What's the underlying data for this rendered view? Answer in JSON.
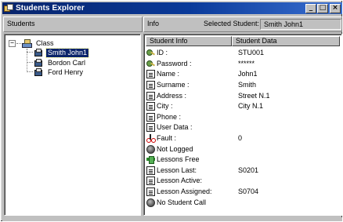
{
  "window": {
    "title": "Students Explorer",
    "controls": [
      "_",
      "□",
      "×"
    ]
  },
  "header": {
    "students_label": "Students",
    "info_label": "Info",
    "selected_label": "Selected Student:",
    "selected_value": "Smith John1"
  },
  "tree": {
    "root_label": "Class",
    "expander": "−",
    "items": [
      {
        "label": "Smith John1",
        "selected": true
      },
      {
        "label": "Bordon Carl",
        "selected": false
      },
      {
        "label": "Ford Henry",
        "selected": false
      }
    ]
  },
  "list": {
    "columns": [
      "Student Info",
      "Student Data"
    ],
    "rows": [
      {
        "icon": "key-icon",
        "label": "ID :",
        "value": "STU001"
      },
      {
        "icon": "key-icon",
        "label": "Password :",
        "value": "******"
      },
      {
        "icon": "document-icon",
        "label": "Name :",
        "value": "John1"
      },
      {
        "icon": "document-icon",
        "label": "Surname :",
        "value": "Smith"
      },
      {
        "icon": "document-icon",
        "label": "Address :",
        "value": "Street N.1"
      },
      {
        "icon": "document-icon",
        "label": "City :",
        "value": "City N.1"
      },
      {
        "icon": "document-icon",
        "label": "Phone :",
        "value": ""
      },
      {
        "icon": "document-icon",
        "label": "User Data :",
        "value": ""
      },
      {
        "icon": "scissors-icon",
        "label": "Fault :",
        "value": "0"
      },
      {
        "icon": "status-circle-icon",
        "label": "Not Logged",
        "value": ""
      },
      {
        "icon": "arrows-icon",
        "label": "Lessons Free",
        "value": ""
      },
      {
        "icon": "document-icon",
        "label": "Lesson Last:",
        "value": "S0201"
      },
      {
        "icon": "document-icon",
        "label": "Lesson Active:",
        "value": ""
      },
      {
        "icon": "document-icon",
        "label": "Lesson Assigned:",
        "value": "S0704"
      },
      {
        "icon": "status-circle-icon",
        "label": "No Student Call",
        "value": ""
      }
    ]
  }
}
